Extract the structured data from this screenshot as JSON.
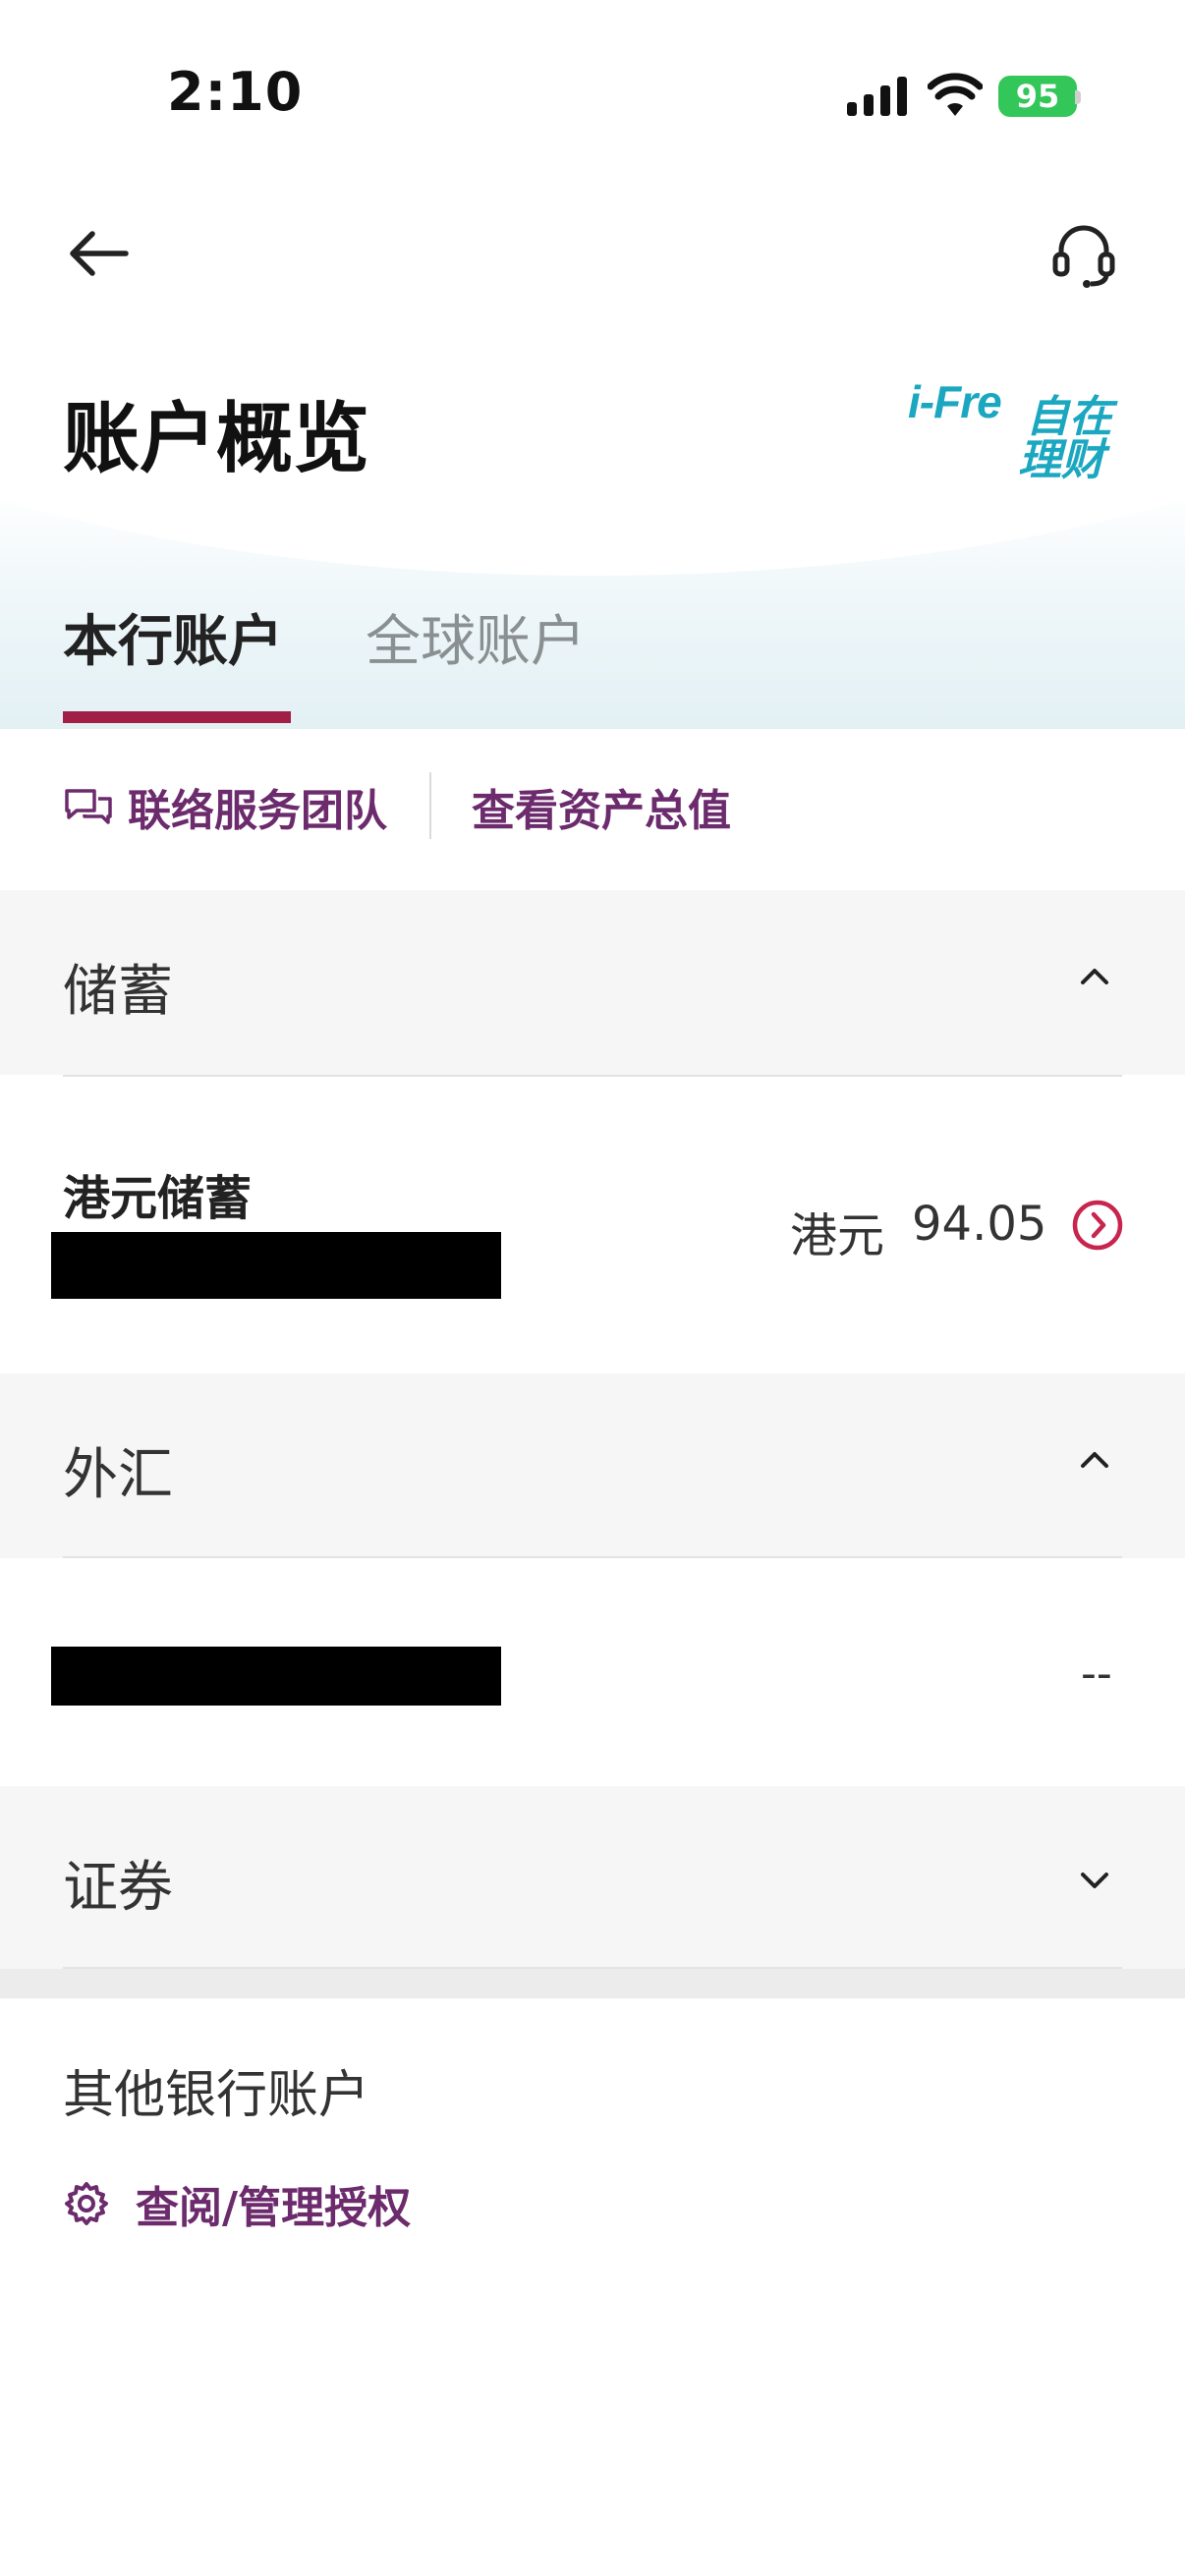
{
  "status_bar": {
    "time": "2:10",
    "battery": "95"
  },
  "header": {
    "title": "账户概览",
    "logo_text_en": "i-Fre",
    "logo_text_cn_1": "自在",
    "logo_text_cn_2": "理财"
  },
  "tabs": [
    {
      "label": "本行账户",
      "active": true
    },
    {
      "label": "全球账户",
      "active": false
    }
  ],
  "quick_links": {
    "contact_team": "联络服务团队",
    "view_assets": "查看资产总值"
  },
  "sections": {
    "savings": {
      "title": "储蓄",
      "expanded": true,
      "account": {
        "name": "港元储蓄",
        "currency": "港元",
        "balance": "94.05"
      }
    },
    "fx": {
      "title": "外汇",
      "expanded": true,
      "value": "--"
    },
    "securities": {
      "title": "证券",
      "expanded": false
    }
  },
  "other_accounts": {
    "title": "其他银行账户",
    "manage_link": "查阅/管理授权"
  },
  "colors": {
    "accent": "#a11f46",
    "link": "#6c2b6c",
    "brand": "#1aa7bf",
    "battery": "#33c759"
  },
  "icons": {
    "back": "arrow-left-icon",
    "support": "headset-icon",
    "chat": "chat-bubbles-icon",
    "detail": "chevron-right-circle-icon",
    "settings": "gear-icon"
  }
}
